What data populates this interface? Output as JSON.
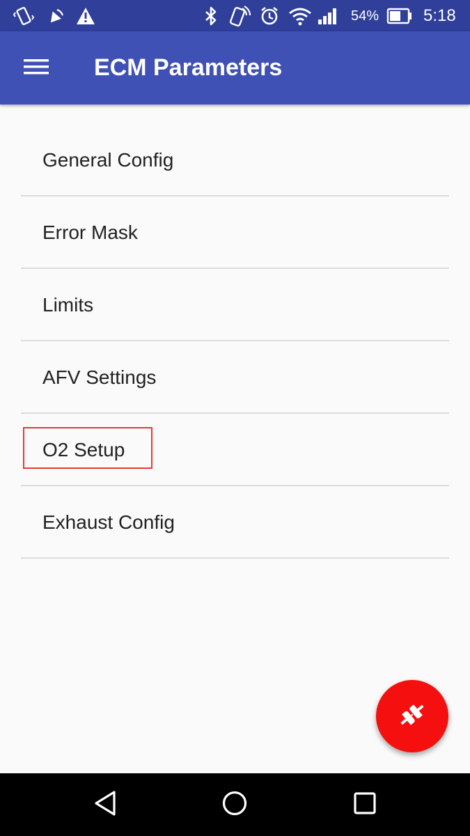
{
  "status_bar": {
    "icons": [
      "vibrate-icon",
      "cast-icon",
      "warning-icon",
      "bluetooth-icon",
      "nfc-icon",
      "alarm-icon",
      "wifi-icon",
      "signal-icon",
      "battery-icon"
    ],
    "battery": "54%",
    "time": "5:18"
  },
  "app_bar": {
    "title": "ECM Parameters",
    "menu_icon": "hamburger-menu-icon"
  },
  "list": {
    "items": [
      {
        "label": "General Config"
      },
      {
        "label": "Error Mask"
      },
      {
        "label": "Limits"
      },
      {
        "label": "AFV Settings"
      },
      {
        "label": "O2 Setup",
        "highlighted": true
      },
      {
        "label": "Exhaust Config"
      }
    ]
  },
  "fab": {
    "icon": "plug-connect-icon",
    "color": "#f50f0f"
  },
  "nav_bar": {
    "buttons": [
      "back-icon",
      "home-icon",
      "recents-icon"
    ]
  },
  "colors": {
    "primary": "#3f51b5",
    "primary_dark": "#2f3f9a",
    "accent": "#f50f0f",
    "highlight": "#e53935"
  }
}
